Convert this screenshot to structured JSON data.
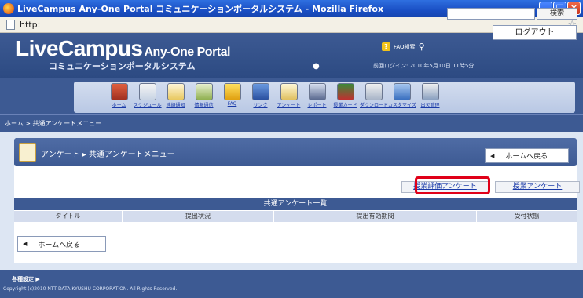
{
  "window": {
    "title": "LiveCampus Any-One Portal コミュニケーションポータルシステム - Mozilla Firefox",
    "url": "http:"
  },
  "header": {
    "logo_main": "LiveCampus",
    "logo_sub": "Any-One Portal",
    "logo_jp": "コミュニケーションポータルシステム",
    "faq_label": "FAQ検索",
    "search_placeholder": "",
    "search_button": "検索",
    "last_login": "前回ログイン: 2010年5月10日 11時5分",
    "logout_button": "ログアウト"
  },
  "nav": {
    "items": [
      {
        "label": "ホーム",
        "icon": "home-icon"
      },
      {
        "label": "スケジュール",
        "icon": "schedule-icon"
      },
      {
        "label": "連絡通知",
        "icon": "notice-icon"
      },
      {
        "label": "情報通信",
        "icon": "info-icon"
      },
      {
        "label": "FAQ",
        "icon": "faq-icon"
      },
      {
        "label": "リンク",
        "icon": "link-icon"
      },
      {
        "label": "アンケート",
        "icon": "survey-icon"
      },
      {
        "label": "レポート",
        "icon": "report-icon"
      },
      {
        "label": "授業カード",
        "icon": "class-card-icon"
      },
      {
        "label": "ダウンロード",
        "icon": "download-icon"
      },
      {
        "label": "カスタマイズ",
        "icon": "customize-icon"
      },
      {
        "label": "出欠管理",
        "icon": "attendance-icon"
      }
    ]
  },
  "breadcrumb": "ホーム > 共通アンケートメニュー",
  "page": {
    "heading": "アンケート ▸ 共通アンケートメニュー",
    "back_home_label": "ホームへ戻る",
    "tab_class_eval": "授業評価アンケート",
    "tab_class": "授業アンケート",
    "table_title": "共通アンケート一覧",
    "columns": [
      "タイトル",
      "提出状況",
      "提出有効期間",
      "受付状態"
    ]
  },
  "footer": {
    "settings_label": "各種設定 ▶",
    "copyright": "Copyright (c)2010 NTT DATA KYUSHU CORPORATION. All Rights Reserved."
  },
  "colors": {
    "header_blue": "#3d5a93",
    "highlight_red": "#e00018",
    "link_blue": "#1a3aa8"
  }
}
